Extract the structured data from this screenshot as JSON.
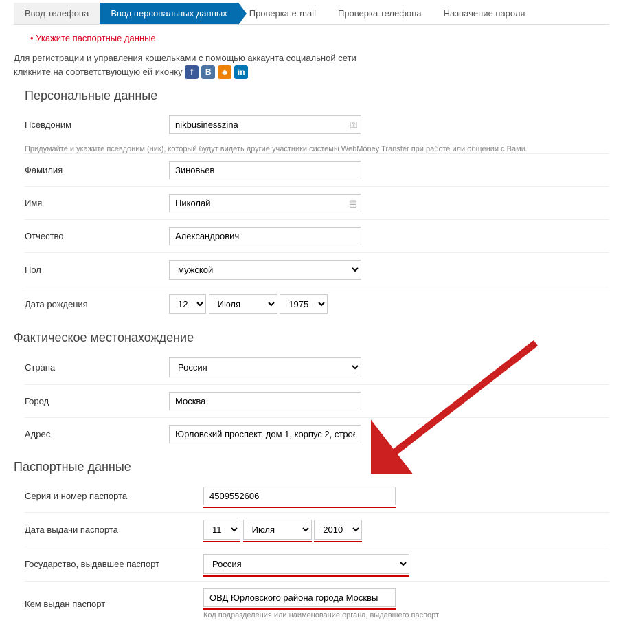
{
  "steps": {
    "phone": "Ввод телефона",
    "personal": "Ввод персональных данных",
    "email": "Проверка e-mail",
    "phone_check": "Проверка телефона",
    "password": "Назначение пароля"
  },
  "error": "Укажите паспортные данные",
  "intro_line1": "Для регистрации и управления кошельками с помощью аккаунта социальной сети",
  "intro_line2_prefix": "кликните на соответствующую ей иконку",
  "social": {
    "fb": "f",
    "vk": "B",
    "ok": "♣",
    "in": "in"
  },
  "sections": {
    "personal": "Персональные данные",
    "location": "Фактическое местонахождение",
    "passport": "Паспортные данные"
  },
  "personal": {
    "nickname_label": "Псевдоним",
    "nickname_value": "nikbusinesszina",
    "nickname_hint": "Придумайте и укажите псевдоним (ник), который будут видеть другие участники системы WebMoney Transfer при работе или общении с Вами.",
    "surname_label": "Фамилия",
    "surname_value": "Зиновьев",
    "name_label": "Имя",
    "name_value": "Николай",
    "patronymic_label": "Отчество",
    "patronymic_value": "Александрович",
    "gender_label": "Пол",
    "gender_value": "мужской",
    "dob_label": "Дата рождения",
    "dob_day": "12",
    "dob_month": "Июля",
    "dob_year": "1975"
  },
  "location": {
    "country_label": "Страна",
    "country_value": "Россия",
    "city_label": "Город",
    "city_value": "Москва",
    "address_label": "Адрес",
    "address_value": "Юрловский проспект, дом 1, корпус 2, строе"
  },
  "passport": {
    "series_label": "Серия и номер паспорта",
    "series_value": "4509552606",
    "issue_date_label": "Дата выдачи паспорта",
    "issue_day": "11",
    "issue_month": "Июля",
    "issue_year": "2010",
    "state_label": "Государство, выдавшее паспорт",
    "state_value": "Россия",
    "issued_by_label": "Кем выдан паспорт",
    "issued_by_value": "ОВД Юрловского района города Москвы",
    "issued_by_hint": "Код подразделения или наименование органа, выдавшего паспорт"
  }
}
